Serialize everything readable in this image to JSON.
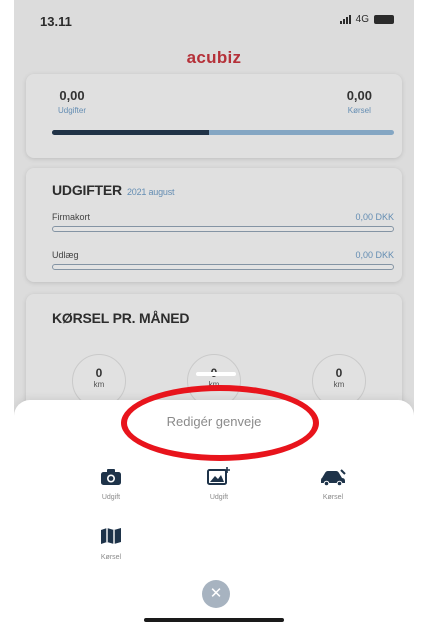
{
  "status": {
    "time": "13.11",
    "network": "4G"
  },
  "brand": "acubiz",
  "summary": {
    "left_value": "0,00",
    "left_label": "Udgifter",
    "right_value": "0,00",
    "right_label": "Kørsel",
    "udgifter_share_percent": 46
  },
  "udgifter": {
    "title": "UDGIFTER",
    "subtitle": "2021 august",
    "rows": [
      {
        "label": "Firmakort",
        "amount": "0,00 DKK"
      },
      {
        "label": "Udlæg",
        "amount": "0,00 DKK"
      }
    ]
  },
  "korsel": {
    "title": "KØRSEL PR. MÅNED",
    "months": [
      {
        "value": "0",
        "unit": "km"
      },
      {
        "value": "0",
        "unit": "km"
      },
      {
        "value": "0",
        "unit": "km"
      }
    ]
  },
  "sheet": {
    "edit_label": "Redigér genveje",
    "shortcuts": [
      {
        "icon": "camera-icon",
        "label": "Udgift"
      },
      {
        "icon": "image-add-icon",
        "label": "Udgift"
      },
      {
        "icon": "car-icon",
        "label": "Kørsel"
      },
      {
        "icon": "map-icon",
        "label": "Kørsel"
      }
    ],
    "close_glyph": "✕"
  },
  "colors": {
    "brand": "#c7303a",
    "accent": "#6a99c4",
    "dark_bar": "#1e3349",
    "highlight": "#e8141c"
  }
}
